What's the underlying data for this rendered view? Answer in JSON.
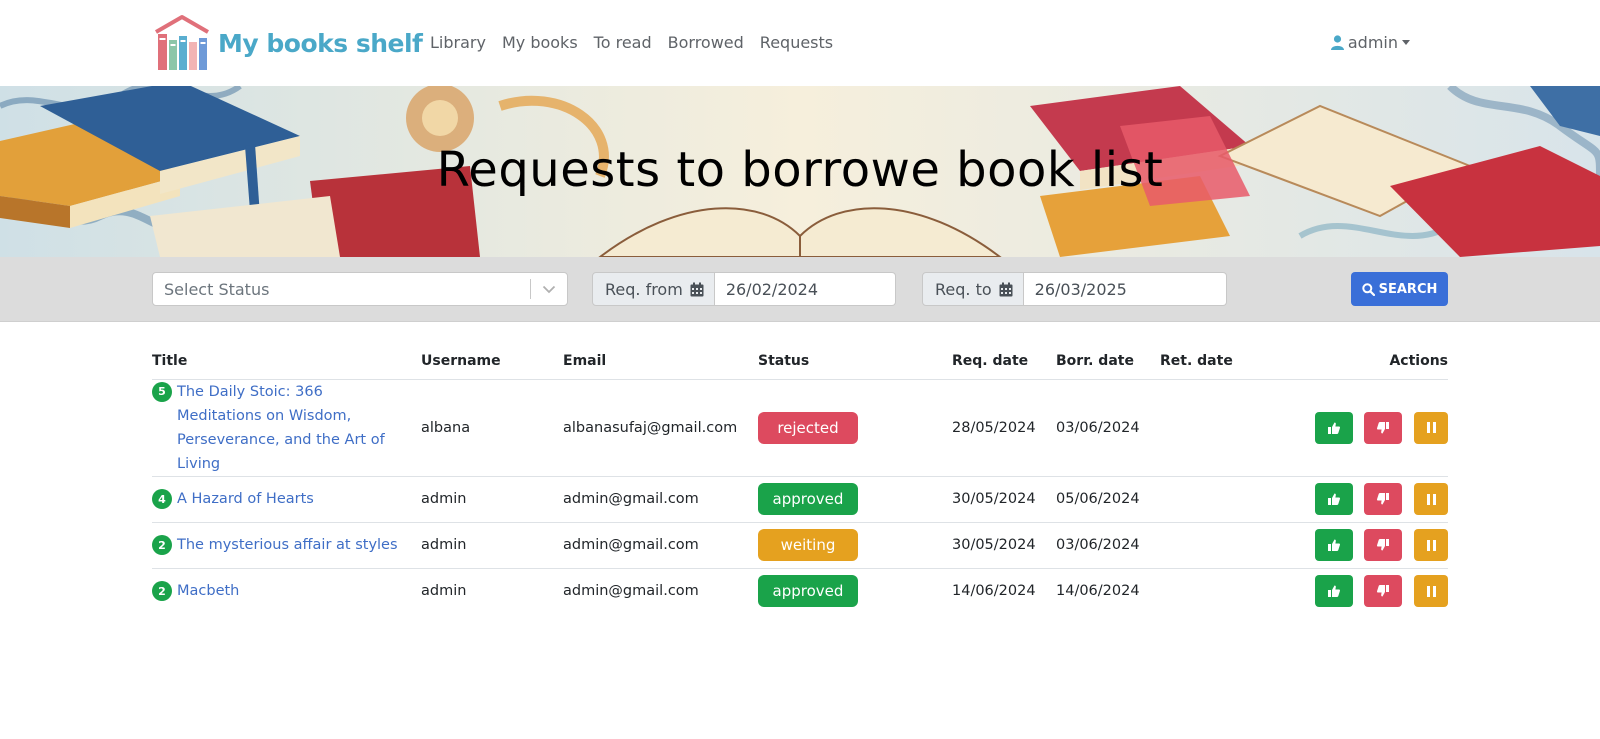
{
  "brand": {
    "name": "My books shelf",
    "logo_icon": "bookshelf-house-logo"
  },
  "nav": {
    "links": [
      "Library",
      "My books",
      "To read",
      "Borrowed",
      "Requests"
    ],
    "user": {
      "label": "admin",
      "icon": "user-icon"
    }
  },
  "hero": {
    "title": "Requests to borrowe book list"
  },
  "filters": {
    "status_placeholder": "Select Status",
    "from_label": "Req. from",
    "from_value": "26/02/2024",
    "to_label": "Req. to",
    "to_value": "26/03/2025",
    "search_label": "SEARCH"
  },
  "table": {
    "headers": {
      "title": "Title",
      "username": "Username",
      "email": "Email",
      "status": "Status",
      "req_date": "Req. date",
      "borr_date": "Borr. date",
      "ret_date": "Ret. date",
      "actions": "Actions"
    },
    "rows": [
      {
        "count": "5",
        "title": "The Daily Stoic: 366 Meditations on Wisdom, Perseverance, and the Art of Living",
        "username": "albana",
        "email": "albanasufaj@gmail.com",
        "status": "rejected",
        "req_date": "28/05/2024",
        "borr_date": "03/06/2024",
        "ret_date": ""
      },
      {
        "count": "4",
        "title": "A Hazard of Hearts",
        "username": "admin",
        "email": "admin@gmail.com",
        "status": "approved",
        "req_date": "30/05/2024",
        "borr_date": "05/06/2024",
        "ret_date": ""
      },
      {
        "count": "2",
        "title": "The mysterious affair at styles",
        "username": "admin",
        "email": "admin@gmail.com",
        "status": "weiting",
        "req_date": "30/05/2024",
        "borr_date": "03/06/2024",
        "ret_date": ""
      },
      {
        "count": "2",
        "title": "Macbeth",
        "username": "admin",
        "email": "admin@gmail.com",
        "status": "approved",
        "req_date": "14/06/2024",
        "borr_date": "14/06/2024",
        "ret_date": ""
      }
    ]
  },
  "colors": {
    "brand": "#4aa8c8",
    "link": "#3f6ec6",
    "approved": "#1aa34a",
    "rejected": "#dd4a5f",
    "waiting": "#e5a11f",
    "search_button": "#3a6fd8",
    "filter_bar": "#dcdcdc"
  }
}
